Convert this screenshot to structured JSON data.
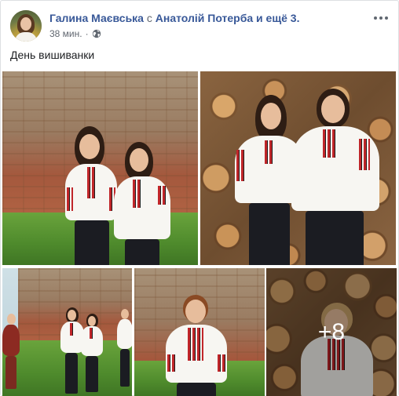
{
  "post": {
    "author": "Галина Маєвська",
    "with_word": "с",
    "tagged": "Анатолій Потерба и ещё 3.",
    "timestamp": "38 мин.",
    "separator": "·",
    "privacy_icon": "globe-icon",
    "more_icon": "ellipsis-icon",
    "text": "День вишиванки"
  },
  "photos": {
    "more_count": "+8"
  },
  "colors": {
    "link": "#385898",
    "meta": "#616770",
    "embroidery_red": "#c0262a"
  }
}
